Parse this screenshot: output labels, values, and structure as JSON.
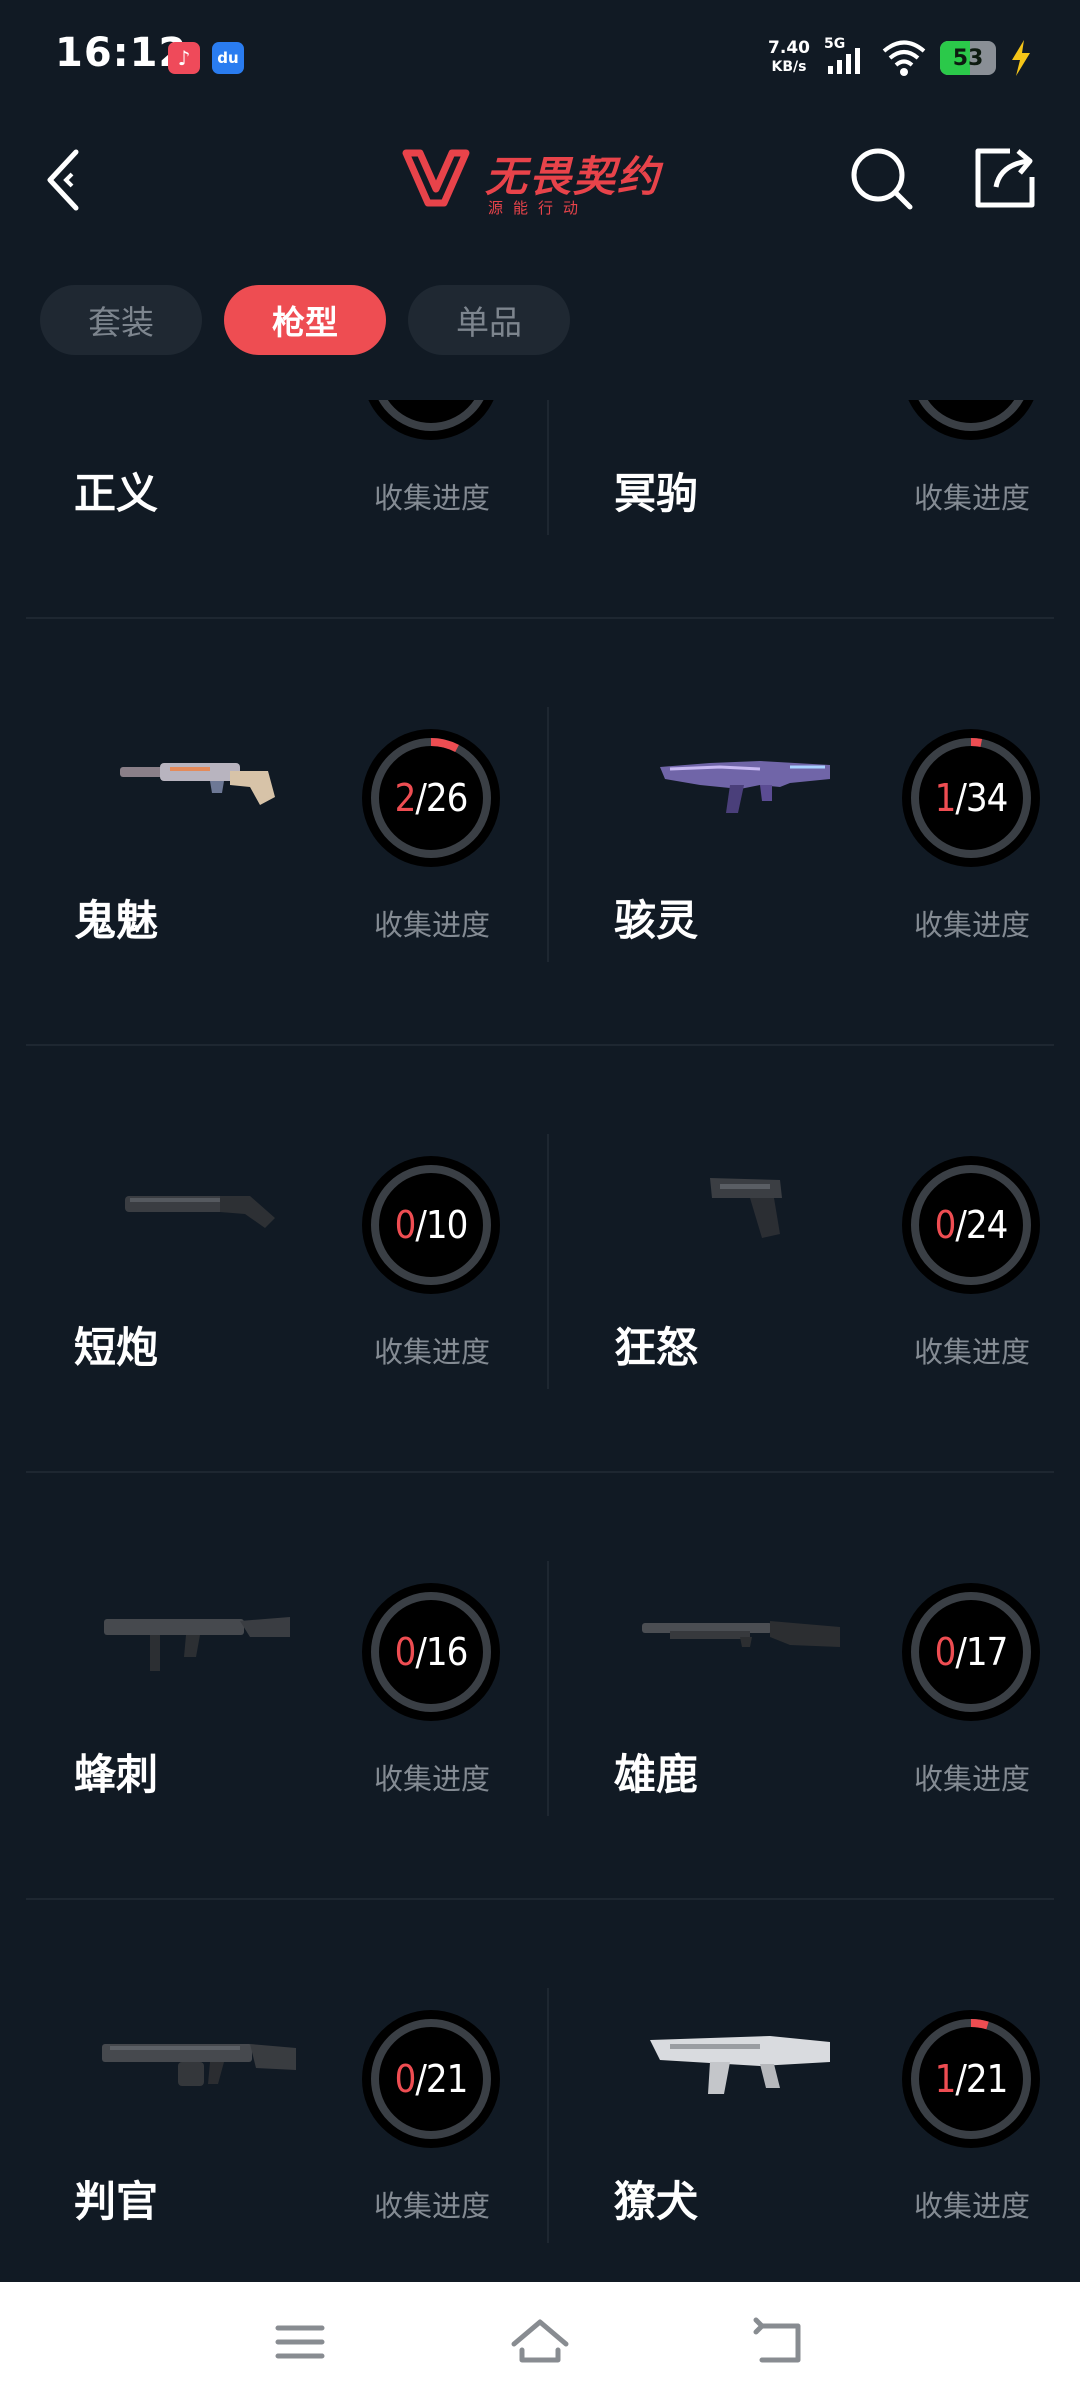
{
  "status_bar": {
    "time": "16:12",
    "net_speed_value": "7.40",
    "net_speed_unit": "KB/s",
    "network": "5G",
    "battery": "53",
    "battery_level": 0.53
  },
  "header": {
    "logo_title": "无畏契约",
    "logo_subtitle": "源能行动"
  },
  "tabs": [
    {
      "label": "套装",
      "active": false
    },
    {
      "label": "枪型",
      "active": true
    },
    {
      "label": "单品",
      "active": false
    }
  ],
  "colors": {
    "accent": "#ee4d52",
    "background": "#111a24",
    "ring_track": "#3a3f45"
  },
  "weapons": [
    {
      "name": "正义",
      "owned": null,
      "total": null,
      "progress_label": "收集进度"
    },
    {
      "name": "冥驹",
      "owned": null,
      "total": null,
      "progress_label": "收集进度"
    },
    {
      "name": "鬼魅",
      "owned": "2",
      "total": "26",
      "progress_label": "收集进度"
    },
    {
      "name": "骇灵",
      "owned": "1",
      "total": "34",
      "progress_label": "收集进度"
    },
    {
      "name": "短炮",
      "owned": "0",
      "total": "10",
      "progress_label": "收集进度"
    },
    {
      "name": "狂怒",
      "owned": "0",
      "total": "24",
      "progress_label": "收集进度"
    },
    {
      "name": "蜂刺",
      "owned": "0",
      "total": "16",
      "progress_label": "收集进度"
    },
    {
      "name": "雄鹿",
      "owned": "0",
      "total": "17",
      "progress_label": "收集进度"
    },
    {
      "name": "判官",
      "owned": "0",
      "total": "21",
      "progress_label": "收集进度"
    },
    {
      "name": "獠犬",
      "owned": "1",
      "total": "21",
      "progress_label": "收集进度"
    }
  ]
}
